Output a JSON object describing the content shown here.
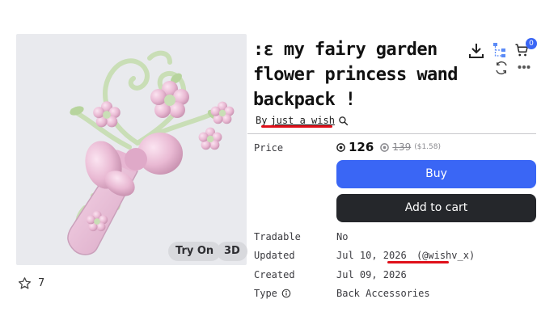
{
  "item": {
    "title_lines": [
      ":ε my fairy garden",
      "flower princess wand",
      "backpack !"
    ],
    "by_prefix": "By",
    "creator": "just a wish",
    "favorites": "7"
  },
  "media": {
    "try_on_label": "Try On",
    "three_d_label": "3D"
  },
  "header": {
    "cart_count": "0"
  },
  "details": {
    "price_label": "Price",
    "price_current": "126",
    "price_original": "139",
    "price_usd": "($1.58)",
    "buy_label": "Buy",
    "add_to_cart_label": "Add to cart",
    "tradable_label": "Tradable",
    "tradable_value": "No",
    "updated_label": "Updated",
    "updated_value": "Jul 10, 2026",
    "updated_by": "(@wishv_x)",
    "created_label": "Created",
    "created_value": "Jul 09, 2026",
    "type_label": "Type",
    "type_value": "Back Accessories"
  },
  "colors": {
    "accent": "#3a66f5",
    "annotation": "#e0101a",
    "dark_button": "#25272b"
  },
  "icons": [
    "download-icon",
    "hierarchy-icon",
    "cart-icon",
    "refresh-icon",
    "more-icon",
    "star-outline-icon",
    "search-icon",
    "robux-icon",
    "info-icon"
  ]
}
